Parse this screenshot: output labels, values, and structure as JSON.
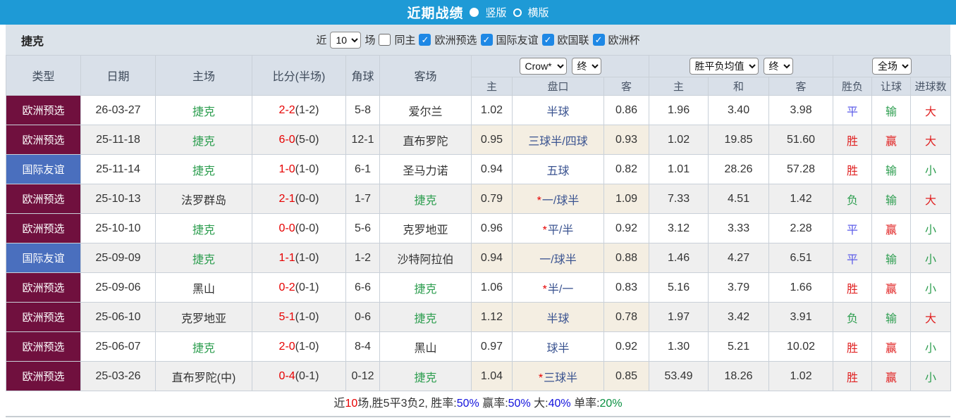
{
  "title_bar": {
    "title": "近期战绩",
    "radio_vertical": "竖版",
    "radio_horizontal": "横版"
  },
  "filter_bar": {
    "team": "捷克",
    "near_label": "近",
    "matches_value": "10",
    "matches_label": "场",
    "same_home_label": "同主",
    "competitions": [
      "欧洲预选",
      "国际友谊",
      "欧国联",
      "欧洲杯"
    ]
  },
  "table": {
    "headers": [
      "类型",
      "日期",
      "主场",
      "比分(半场)",
      "角球",
      "客场"
    ],
    "groups": {
      "odds_company": "Crow*",
      "odds_period": "终",
      "avg_label": "胜平负均值",
      "avg_period": "终",
      "result_scope": "全场"
    },
    "subheaders": [
      "主",
      "盘口",
      "客",
      "主",
      "和",
      "客",
      "胜负",
      "让球",
      "进球数"
    ],
    "rows": [
      {
        "type": "欧洲预选",
        "date": "26-03-27",
        "home": "捷克",
        "homeCzech": true,
        "score": "2-2",
        "half": "(1-2)",
        "corners": "5-8",
        "away": "爱尔兰",
        "awayCzech": false,
        "o1": "1.02",
        "pan": "半球",
        "star": false,
        "o2": "0.86",
        "avg": [
          "1.96",
          "3.40",
          "3.98"
        ],
        "res": [
          "平",
          "输",
          "大"
        ]
      },
      {
        "type": "欧洲预选",
        "date": "25-11-18",
        "home": "捷克",
        "homeCzech": true,
        "score": "6-0",
        "half": "(5-0)",
        "corners": "12-1",
        "away": "直布罗陀",
        "awayCzech": false,
        "o1": "0.95",
        "pan": "三球半/四球",
        "star": false,
        "o2": "0.93",
        "avg": [
          "1.02",
          "19.85",
          "51.60"
        ],
        "res": [
          "胜",
          "赢",
          "大"
        ]
      },
      {
        "type": "国际友谊",
        "date": "25-11-14",
        "home": "捷克",
        "homeCzech": true,
        "score": "1-0",
        "half": "(1-0)",
        "corners": "6-1",
        "away": "圣马力诺",
        "awayCzech": false,
        "o1": "0.94",
        "pan": "五球",
        "star": false,
        "o2": "0.82",
        "avg": [
          "1.01",
          "28.26",
          "57.28"
        ],
        "res": [
          "胜",
          "输",
          "小"
        ]
      },
      {
        "type": "欧洲预选",
        "date": "25-10-13",
        "home": "法罗群岛",
        "homeCzech": false,
        "score": "2-1",
        "half": "(0-0)",
        "corners": "1-7",
        "away": "捷克",
        "awayCzech": true,
        "o1": "0.79",
        "pan": "一/球半",
        "star": true,
        "o2": "1.09",
        "avg": [
          "7.33",
          "4.51",
          "1.42"
        ],
        "res": [
          "负",
          "输",
          "大"
        ]
      },
      {
        "type": "欧洲预选",
        "date": "25-10-10",
        "home": "捷克",
        "homeCzech": true,
        "score": "0-0",
        "half": "(0-0)",
        "corners": "5-6",
        "away": "克罗地亚",
        "awayCzech": false,
        "o1": "0.96",
        "pan": "平/半",
        "star": true,
        "o2": "0.92",
        "avg": [
          "3.12",
          "3.33",
          "2.28"
        ],
        "res": [
          "平",
          "赢",
          "小"
        ]
      },
      {
        "type": "国际友谊",
        "date": "25-09-09",
        "home": "捷克",
        "homeCzech": true,
        "score": "1-1",
        "half": "(1-0)",
        "corners": "1-2",
        "away": "沙特阿拉伯",
        "awayCzech": false,
        "o1": "0.94",
        "pan": "一/球半",
        "star": false,
        "o2": "0.88",
        "avg": [
          "1.46",
          "4.27",
          "6.51"
        ],
        "res": [
          "平",
          "输",
          "小"
        ]
      },
      {
        "type": "欧洲预选",
        "date": "25-09-06",
        "home": "黑山",
        "homeCzech": false,
        "score": "0-2",
        "half": "(0-1)",
        "corners": "6-6",
        "away": "捷克",
        "awayCzech": true,
        "o1": "1.06",
        "pan": "半/一",
        "star": true,
        "o2": "0.83",
        "avg": [
          "5.16",
          "3.79",
          "1.66"
        ],
        "res": [
          "胜",
          "赢",
          "小"
        ]
      },
      {
        "type": "欧洲预选",
        "date": "25-06-10",
        "home": "克罗地亚",
        "homeCzech": false,
        "score": "5-1",
        "half": "(1-0)",
        "corners": "0-6",
        "away": "捷克",
        "awayCzech": true,
        "o1": "1.12",
        "pan": "半球",
        "star": false,
        "o2": "0.78",
        "avg": [
          "1.97",
          "3.42",
          "3.91"
        ],
        "res": [
          "负",
          "输",
          "大"
        ]
      },
      {
        "type": "欧洲预选",
        "date": "25-06-07",
        "home": "捷克",
        "homeCzech": true,
        "score": "2-0",
        "half": "(1-0)",
        "corners": "8-4",
        "away": "黑山",
        "awayCzech": false,
        "o1": "0.97",
        "pan": "球半",
        "star": false,
        "o2": "0.92",
        "avg": [
          "1.30",
          "5.21",
          "10.02"
        ],
        "res": [
          "胜",
          "赢",
          "小"
        ]
      },
      {
        "type": "欧洲预选",
        "date": "25-03-26",
        "home": "直布罗陀(中)",
        "homeCzech": false,
        "score": "0-4",
        "half": "(0-1)",
        "corners": "0-12",
        "away": "捷克",
        "awayCzech": true,
        "o1": "1.04",
        "pan": "三球半",
        "star": true,
        "o2": "0.85",
        "avg": [
          "53.49",
          "18.26",
          "1.02"
        ],
        "res": [
          "胜",
          "赢",
          "小"
        ]
      }
    ]
  },
  "footer": {
    "segments": [
      {
        "t": "近",
        "c": "black"
      },
      {
        "t": "10",
        "c": "red"
      },
      {
        "t": "场,胜5平3负2, 胜率:",
        "c": "black"
      },
      {
        "t": "50%",
        "c": "blue"
      },
      {
        "t": " 赢率:",
        "c": "black"
      },
      {
        "t": "50%",
        "c": "blue"
      },
      {
        "t": " 大:",
        "c": "black"
      },
      {
        "t": "40%",
        "c": "blue"
      },
      {
        "t": " 单率:",
        "c": "black"
      },
      {
        "t": "20%",
        "c": "green"
      }
    ]
  },
  "colors": {
    "topbar": "#1E9AD6",
    "badge": {
      "欧洲预选": "#70103E",
      "国际友谊": "#4A6FBE"
    },
    "czech_green": "#2E9E50",
    "score_red": "#E60000",
    "handicap_blue": "#3A5390",
    "result_text": {
      "胜": "#E02222",
      "平": "#5B5BE8",
      "负": "#2E9E50",
      "赢": "#E02222",
      "输": "#2E9E50",
      "大": "#E02222",
      "小": "#2E9E50"
    },
    "footer": {
      "black": "#333333",
      "red": "#E60000",
      "blue": "#1212DD",
      "green": "#089040"
    }
  }
}
